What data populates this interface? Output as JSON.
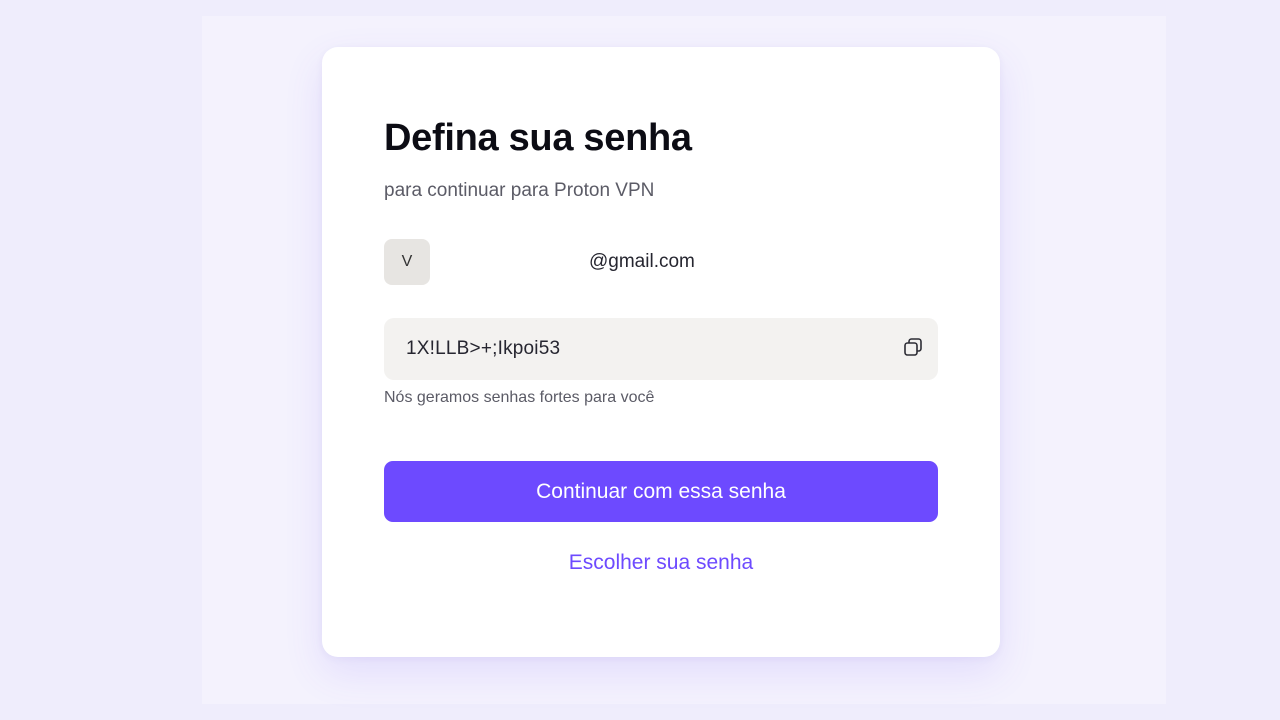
{
  "card": {
    "title": "Defina sua senha",
    "subtitle": "para continuar para Proton VPN"
  },
  "account": {
    "avatar_initial": "V",
    "email": "@gmail.com"
  },
  "password": {
    "value": "1X!LLB>+;Ikpoi53",
    "copy_icon": "copy-icon",
    "hint": "Nós geramos senhas fortes para você"
  },
  "actions": {
    "primary_label": "Continuar com essa senha",
    "secondary_label": "Escolher sua senha"
  },
  "colors": {
    "accent": "#6d4aff",
    "background": "#efedfc",
    "field_background": "#f3f2f0"
  }
}
